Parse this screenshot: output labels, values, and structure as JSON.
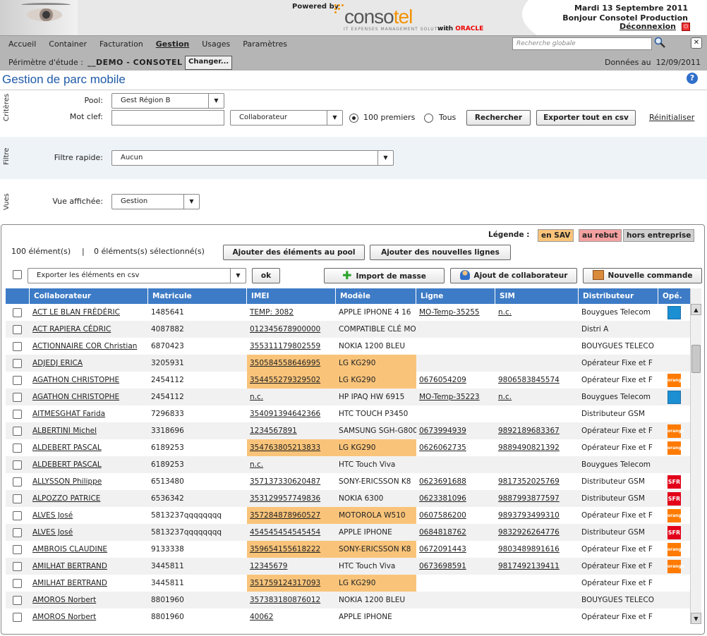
{
  "header": {
    "powered_by": "Powered by",
    "brand_prefix": "conso",
    "brand_suffix": "tel",
    "tagline": "IT EXPENSES MANAGEMENT SOLUTIONS",
    "with": "with",
    "oracle": "ORACLE",
    "date": "Mardi 13 Septembre 2011",
    "greeting": "Bonjour Consotel Production",
    "logout": "Déconnexion"
  },
  "nav": {
    "menu": [
      "Accueil",
      "Container",
      "Facturation",
      "Gestion",
      "Usages",
      "Paramètres"
    ],
    "active": "Gestion",
    "search_placeholder": "Recherche globale",
    "perimeter_label": "Périmètre d'étude :",
    "perimeter_value": "__DEMO - CONSOTEL",
    "perimeter_sep": "/",
    "change_label": "Changer...",
    "data_label": "Données au",
    "data_date": "12/09/2011"
  },
  "page": {
    "title": "Gestion de parc mobile",
    "help": "?"
  },
  "criteria": {
    "side_label": "Critères",
    "pool_label": "Pool:",
    "pool_value": "Gest Région B",
    "keyword_label": "Mot clef:",
    "keyword_value": "",
    "field_value": "Collaborateur",
    "radio_first": "100 premiers",
    "radio_all": "Tous",
    "search_btn": "Rechercher",
    "export_btn": "Exporter tout en csv",
    "reset_link": "Réinitialiser"
  },
  "filter": {
    "side_label": "Filtre",
    "label": "Filtre rapide:",
    "value": "Aucun"
  },
  "views": {
    "side_label": "Vues",
    "label": "Vue affichée:",
    "value": "Gestion"
  },
  "panel": {
    "legend_label": "Légende :",
    "legend": [
      {
        "label": "en SAV",
        "color": "#f9c47a"
      },
      {
        "label": "au rebut",
        "color": "#f4a0a0"
      },
      {
        "label": "hors entreprise",
        "color": "#d0d0d0"
      }
    ],
    "count_elements": "100 élément(s)",
    "count_sep": "|",
    "count_selected": "0 éléments(s) sélectionné(s)",
    "add_pool_btn": "Ajouter des éléments au pool",
    "add_lines_btn": "Ajouter des nouvelles lignes",
    "export_select": "Exporter les éléments en csv",
    "ok_btn": "ok",
    "import_btn": "Import de masse",
    "add_collab_btn": "Ajout de collaborateur",
    "new_order_btn": "Nouvelle commande"
  },
  "table": {
    "columns": [
      "Collaborateur",
      "Matricule",
      "IMEI",
      "Modèle",
      "Ligne",
      "SIM",
      "Distributeur",
      "Opé."
    ],
    "rows": [
      {
        "collab": "ACT LE BLAN FRÉDÉRIC",
        "mat": "1485641",
        "imei": "TEMP: 3082",
        "modele": "APPLE IPHONE 4 16",
        "ligne": "MO-Temp-35255",
        "sim": "n.c.",
        "dist": "Bouygues Telecom",
        "op": "bouygues",
        "sav": false
      },
      {
        "collab": "ACT RAPIERA CÉDRIC",
        "mat": "4087882",
        "imei": "012345678900000",
        "modele": "COMPATIBLE CLÉ MO",
        "ligne": "",
        "sim": "",
        "dist": "Distri A",
        "op": "",
        "sav": false
      },
      {
        "collab": "ACTIONNAIRE COR Christian",
        "mat": "6870423",
        "imei": "355311179802559",
        "modele": "NOKIA 1200 BLEU",
        "ligne": "",
        "sim": "",
        "dist": "BOUYGUES TELECO",
        "op": "",
        "sav": false
      },
      {
        "collab": "ADJEDJ ERICA",
        "mat": "3205931",
        "imei": "350584558646995",
        "modele": "LG KG290",
        "ligne": "",
        "sim": "",
        "dist": "Opérateur Fixe et F",
        "op": "",
        "sav": true
      },
      {
        "collab": "AGATHON CHRISTOPHE",
        "mat": "2454112",
        "imei": "354455279329502",
        "modele": "LG KG290",
        "ligne": "0676054209",
        "sim": "9806583845574",
        "dist": "Opérateur Fixe et F",
        "op": "orange",
        "sav": true
      },
      {
        "collab": "AGATHON CHRISTOPHE",
        "mat": "2454112",
        "imei": "n.c.",
        "modele": "HP IPAQ HW 6915",
        "ligne": "MO-Temp-35223",
        "sim": "n.c.",
        "dist": "Bouygues Telecom",
        "op": "bouygues",
        "sav": false
      },
      {
        "collab": "AITMESGHAT Farida",
        "mat": "7296833",
        "imei": "354091394642366",
        "modele": "HTC TOUCH P3450",
        "ligne": "",
        "sim": "",
        "dist": "Distributeur GSM",
        "op": "",
        "sav": false
      },
      {
        "collab": "ALBERTINI Michel",
        "mat": "3318696",
        "imei": "1234567891",
        "modele": "SAMSUNG SGH-G800",
        "ligne": "0673994939",
        "sim": "9892189683367",
        "dist": "Opérateur Fixe et F",
        "op": "orange",
        "sav": false
      },
      {
        "collab": "ALDEBERT PASCAL",
        "mat": "6189253",
        "imei": "354763805213833",
        "modele": "LG KG290",
        "ligne": "0626062735",
        "sim": "9889490821392",
        "dist": "Opérateur Fixe et F",
        "op": "orange",
        "sav": true
      },
      {
        "collab": "ALDEBERT PASCAL",
        "mat": "6189253",
        "imei": "n.c.",
        "modele": "HTC Touch Viva",
        "ligne": "",
        "sim": "",
        "dist": "Bouygues Telecom",
        "op": "",
        "sav": false
      },
      {
        "collab": "ALLYSSON Philippe",
        "mat": "6513480",
        "imei": "357137330620487",
        "modele": "SONY-ERICSSON K8",
        "ligne": "0623691688",
        "sim": "9817352025769",
        "dist": "Distributeur GSM",
        "op": "sfr",
        "sav": false
      },
      {
        "collab": "ALPOZZO PATRICE",
        "mat": "6536342",
        "imei": "353129957749836",
        "modele": "NOKIA 6300",
        "ligne": "0623381096",
        "sim": "9887993877597",
        "dist": "Distributeur GSM",
        "op": "sfr",
        "sav": false
      },
      {
        "collab": "ALVES José",
        "mat": "5813237qqqqqqqq",
        "imei": "357284878960527",
        "modele": "MOTOROLA W510",
        "ligne": "0607586200",
        "sim": "9893793499310",
        "dist": "Opérateur Fixe et F",
        "op": "orange",
        "sav": true
      },
      {
        "collab": "ALVES José",
        "mat": "5813237qqqqqqqq",
        "imei": "454545454545454",
        "modele": "APPLE IPHONE",
        "ligne": "0684818762",
        "sim": "9832926264776",
        "dist": "Distributeur GSM",
        "op": "sfr",
        "sav": false
      },
      {
        "collab": "AMBROIS CLAUDINE",
        "mat": "9133338",
        "imei": "359654155618222",
        "modele": "SONY-ERICSSON K8",
        "ligne": "0672091443",
        "sim": "9803489891616",
        "dist": "Opérateur Fixe et F",
        "op": "orange",
        "sav": true
      },
      {
        "collab": "AMILHAT BERTRAND",
        "mat": "3445811",
        "imei": "12345679",
        "modele": "HTC Touch Viva",
        "ligne": "0673698591",
        "sim": "9817492139411",
        "dist": "Opérateur Fixe et F",
        "op": "orange",
        "sav": false
      },
      {
        "collab": "AMILHAT BERTRAND",
        "mat": "3445811",
        "imei": "351759124317093",
        "modele": "LG KG290",
        "ligne": "",
        "sim": "",
        "dist": "Opérateur Fixe et F",
        "op": "",
        "sav": true
      },
      {
        "collab": "AMOROS Norbert",
        "mat": "8801960",
        "imei": "357383180876012",
        "modele": "NOKIA 1200 BLEU",
        "ligne": "",
        "sim": "",
        "dist": "BOUYGUES TELECO",
        "op": "",
        "sav": false
      },
      {
        "collab": "AMOROS Norbert",
        "mat": "8801960",
        "imei": "40062",
        "modele": "APPLE IPHONE",
        "ligne": "",
        "sim": "",
        "dist": "Opérateur Fixe et F",
        "op": "",
        "sav": false
      }
    ]
  }
}
